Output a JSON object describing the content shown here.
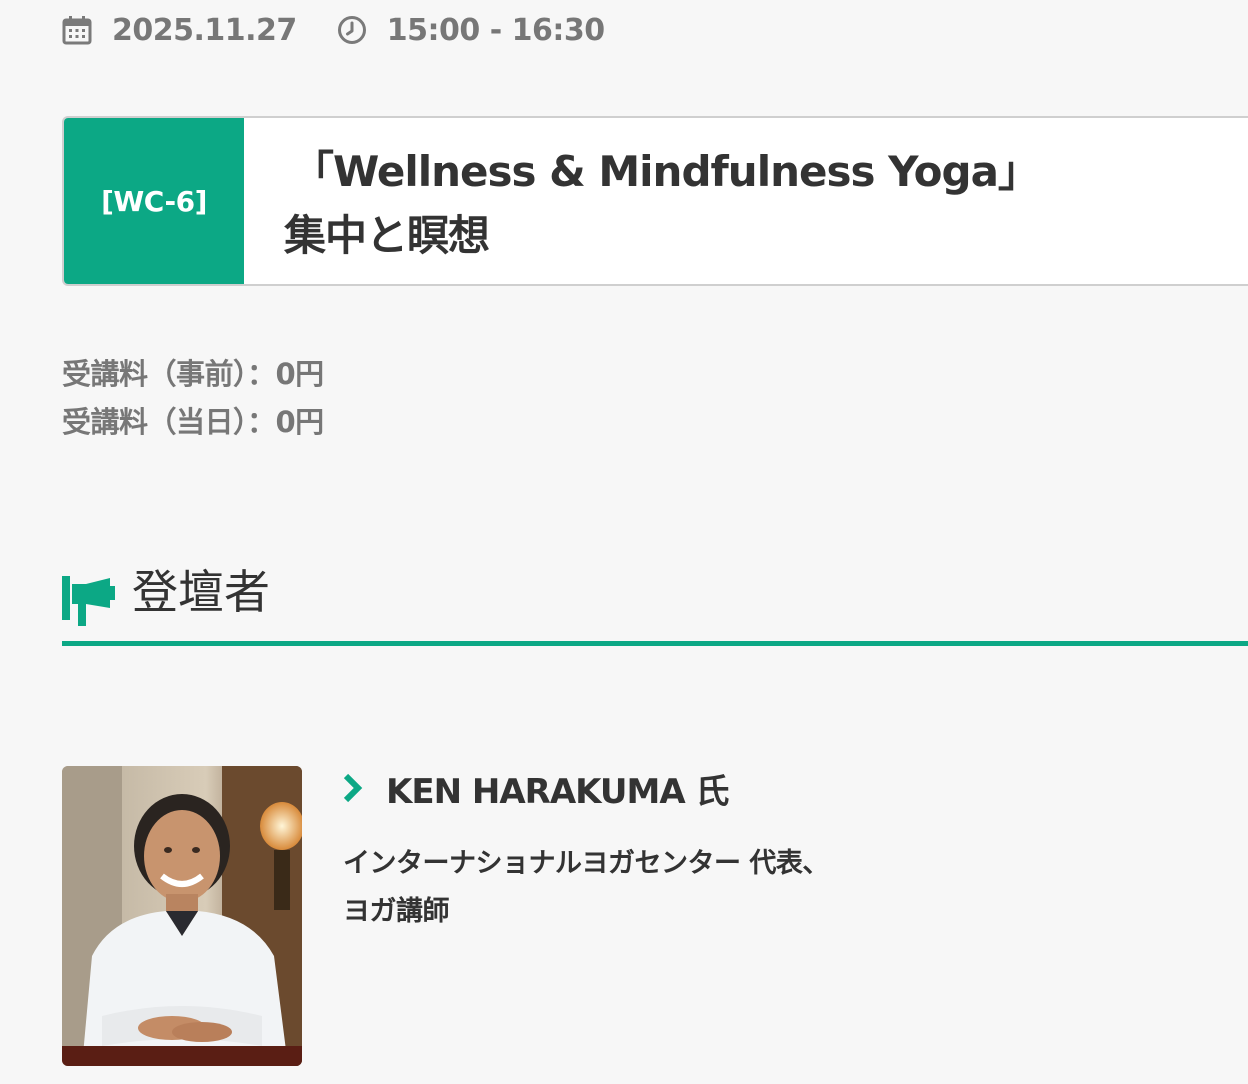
{
  "event": {
    "date": "2025.11.27",
    "time": "15:00 - 16:30",
    "date_icon": "calendar-icon",
    "time_icon": "clock-icon"
  },
  "session": {
    "code": "[WC-6]",
    "title_line1": "「Wellness & Mindfulness Yoga」",
    "title_line2": "集中と瞑想"
  },
  "fees": {
    "advance": "受講料（事前）：0円",
    "same_day": "受講料（当日）：0円"
  },
  "speakers_section": {
    "title": "登壇者",
    "icon": "megaphone-icon"
  },
  "speaker": {
    "name": "KEN HARAKUMA 氏",
    "role_line1": "インターナショナルヨガセンター 代表、",
    "role_line2": "ヨガ講師",
    "icon": "chevron-right-icon"
  },
  "colors": {
    "accent": "#0ca885",
    "text": "#333333",
    "muted": "#777777",
    "background": "#f7f7f7"
  }
}
